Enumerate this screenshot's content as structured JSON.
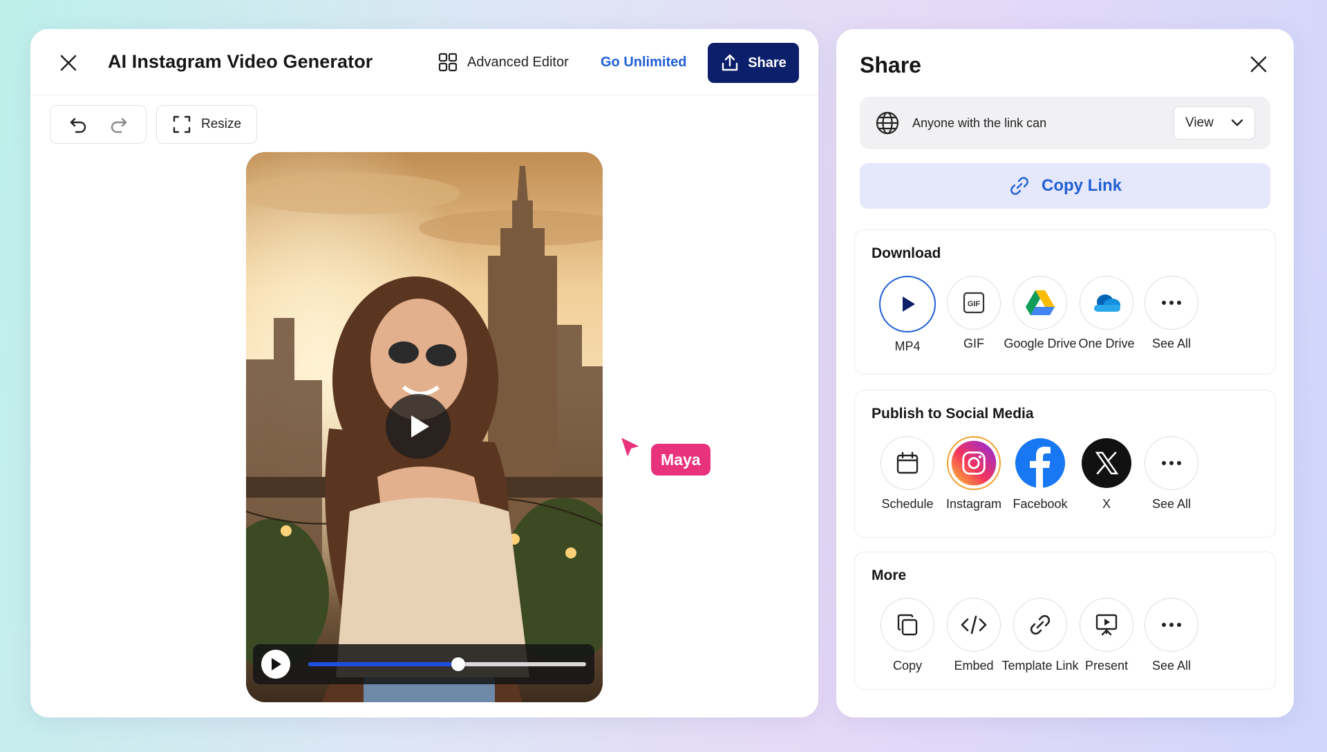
{
  "editor": {
    "title": "AI Instagram Video Generator",
    "advanced_editor_label": "Advanced Editor",
    "go_unlimited_label": "Go Unlimited",
    "share_label": "Share",
    "resize_label": "Resize",
    "collaborator_name": "Maya",
    "playback_progress": 0.54
  },
  "share": {
    "title": "Share",
    "access_text": "Anyone with the link can",
    "access_value": "View",
    "copy_link_label": "Copy Link",
    "download": {
      "title": "Download",
      "items": [
        {
          "label": "MP4",
          "icon": "mp4-play-icon"
        },
        {
          "label": "GIF",
          "icon": "gif-icon",
          "badge": "GIF"
        },
        {
          "label": "Google Drive",
          "icon": "google-drive-icon"
        },
        {
          "label": "One Drive",
          "icon": "onedrive-icon"
        },
        {
          "label": "See All",
          "icon": "more-icon"
        }
      ]
    },
    "social": {
      "title": "Publish to Social Media",
      "items": [
        {
          "label": "Schedule",
          "icon": "calendar-icon"
        },
        {
          "label": "Instagram",
          "icon": "instagram-icon"
        },
        {
          "label": "Facebook",
          "icon": "facebook-icon"
        },
        {
          "label": "X",
          "icon": "x-logo-icon"
        },
        {
          "label": "See All",
          "icon": "more-icon"
        }
      ]
    },
    "more": {
      "title": "More",
      "items": [
        {
          "label": "Copy",
          "icon": "copy-icon"
        },
        {
          "label": "Embed",
          "icon": "code-icon"
        },
        {
          "label": "Template Link",
          "icon": "link-icon"
        },
        {
          "label": "Present",
          "icon": "present-icon"
        },
        {
          "label": "See All",
          "icon": "more-icon"
        }
      ]
    }
  },
  "colors": {
    "primary_navy": "#0c1f6b",
    "link_blue": "#1f5fd6",
    "copy_link_bg": "#e5e7fb",
    "collaborator_pink": "#e8327c",
    "progress_blue": "#1f4fe0"
  }
}
